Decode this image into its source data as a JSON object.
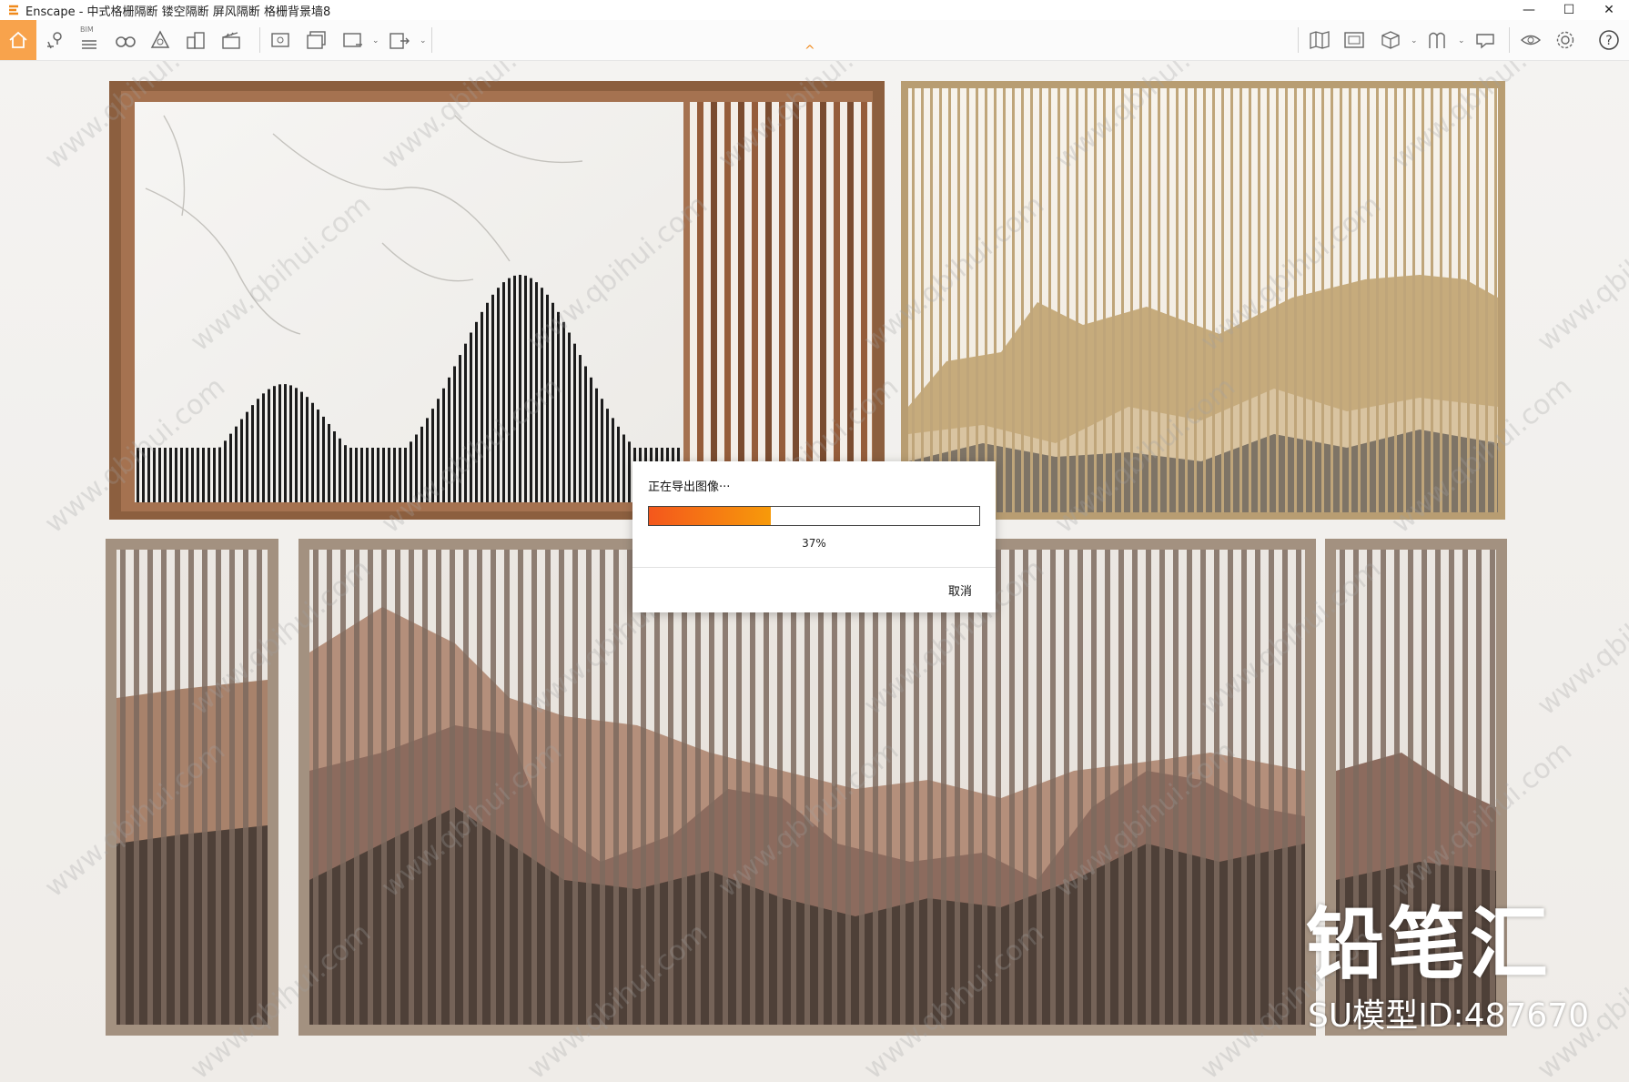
{
  "window": {
    "title": "Enscape - 中式格栅隔断 镂空隔断 屏风隔断 格栅背景墙8",
    "minimize": "—",
    "maximize": "☐",
    "close": "✕"
  },
  "toolbar": {
    "bim_label": "BIM",
    "chevron": "^",
    "left_icons": [
      "home-icon",
      "location-icon",
      "bim-icon",
      "binoculars-icon",
      "atmosphere-icon",
      "buildings-icon",
      "clapper-icon",
      "screenshot-icon",
      "batch-render-icon",
      "panorama-icon",
      "export-icon"
    ],
    "right_icons": [
      "map-icon",
      "asset-library-icon",
      "cube-icon",
      "material-icon",
      "feedback-icon",
      "eye-icon",
      "settings-icon",
      "help-icon"
    ]
  },
  "dialog": {
    "title": "正在导出图像···",
    "progress": 0.37,
    "progress_label": "37%",
    "cancel_label": "取消"
  },
  "watermark": {
    "brand": "铅笔汇",
    "model_id": "SU模型ID:487670",
    "tile_text": "www.qbihui.com"
  },
  "colors": {
    "accent": "#f8a34c",
    "progress_start": "#f4571c",
    "progress_end": "#f79a0a"
  }
}
